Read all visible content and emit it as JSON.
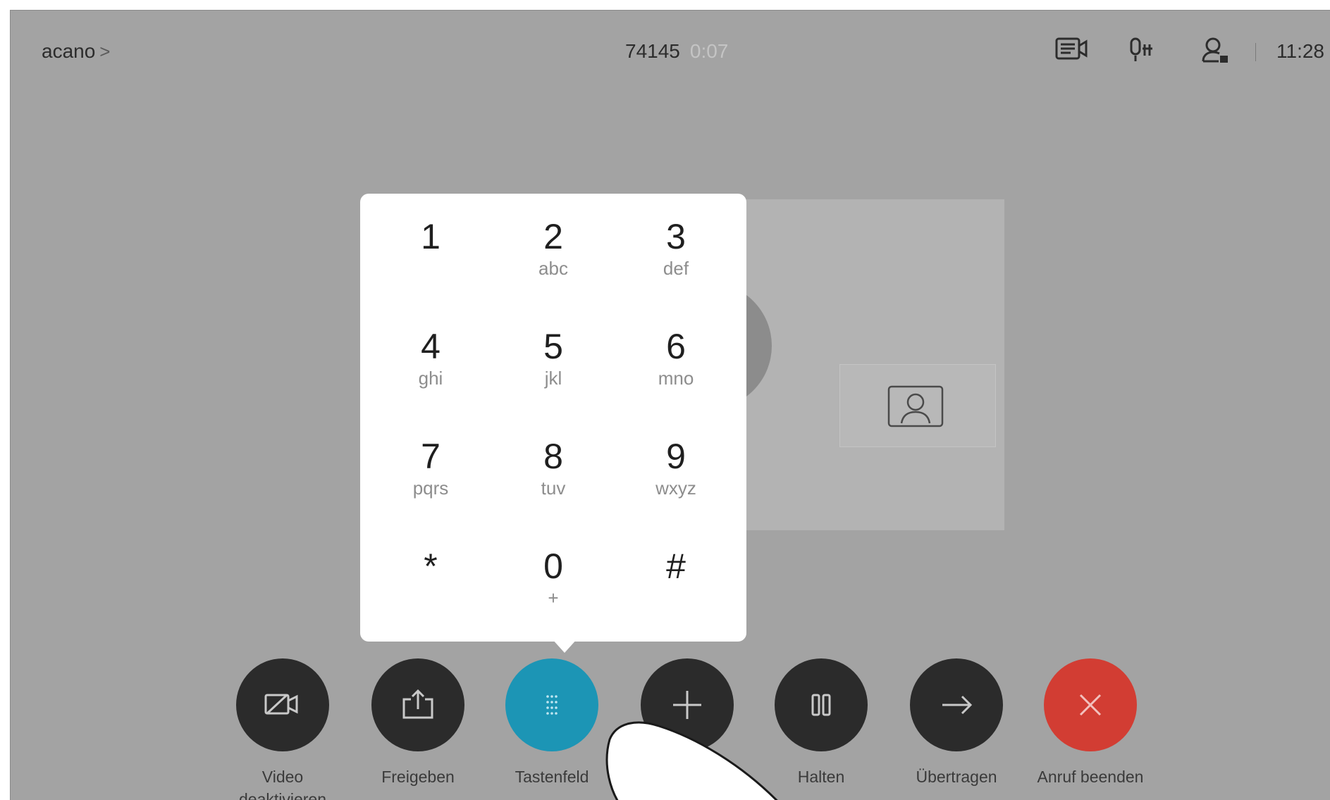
{
  "header": {
    "site_name": "acano",
    "site_chevron": ">",
    "call_number": "74145",
    "call_timer": "0:07",
    "clock": "11:28",
    "icons": [
      "camera-status-icon",
      "microphone-status-icon",
      "user-status-icon"
    ]
  },
  "keypad": {
    "keys": [
      {
        "digit": "1",
        "letters": ""
      },
      {
        "digit": "2",
        "letters": "abc"
      },
      {
        "digit": "3",
        "letters": "def"
      },
      {
        "digit": "4",
        "letters": "ghi"
      },
      {
        "digit": "5",
        "letters": "jkl"
      },
      {
        "digit": "6",
        "letters": "mno"
      },
      {
        "digit": "7",
        "letters": "pqrs"
      },
      {
        "digit": "8",
        "letters": "tuv"
      },
      {
        "digit": "9",
        "letters": "wxyz"
      },
      {
        "digit": "*",
        "letters": ""
      },
      {
        "digit": "0",
        "letters": "+"
      },
      {
        "digit": "#",
        "letters": ""
      }
    ]
  },
  "controls": [
    {
      "label": "Video\ndeaktivieren",
      "icon": "video-off-icon"
    },
    {
      "label": "Freigeben",
      "icon": "share-icon"
    },
    {
      "label": "Tastenfeld",
      "icon": "keypad-icon",
      "active": true
    },
    {
      "label": "",
      "icon": "add-icon"
    },
    {
      "label": "Halten",
      "icon": "pause-icon"
    },
    {
      "label": "Übertragen",
      "icon": "transfer-icon"
    },
    {
      "label": "Anruf beenden",
      "icon": "end-call-icon"
    }
  ],
  "colors": {
    "background": "#a3a3a3",
    "active_button": "#1c95b5",
    "end_call_button": "#d23d33",
    "button": "#2b2b2b"
  }
}
